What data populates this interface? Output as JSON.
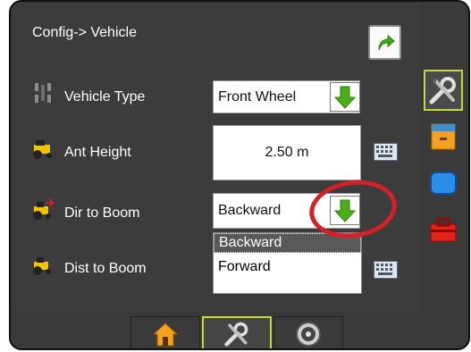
{
  "header": {
    "title": "Config-> Vehicle"
  },
  "rows": {
    "vehicle_type": {
      "label": "Vehicle Type",
      "value": "Front Wheel"
    },
    "ant_height": {
      "label": "Ant Height",
      "value": "2.50 m"
    },
    "dir_to_boom": {
      "label": "Dir to Boom",
      "value": "Backward"
    },
    "dist_to_boom": {
      "label": "Dist to Boom"
    }
  },
  "dropdown": {
    "options": [
      "Backward",
      "Forward"
    ],
    "selected": "Backward"
  },
  "side_tabs": [
    "tools-tab",
    "console-tab",
    "display-tab",
    "toolbox-tab"
  ],
  "bottom_tabs": [
    "home-tab",
    "config-tab",
    "gauge-tab"
  ],
  "colors": {
    "accent_green": "#4caf1a",
    "highlight_red": "#d42128",
    "active_border": "#c6d83a"
  }
}
